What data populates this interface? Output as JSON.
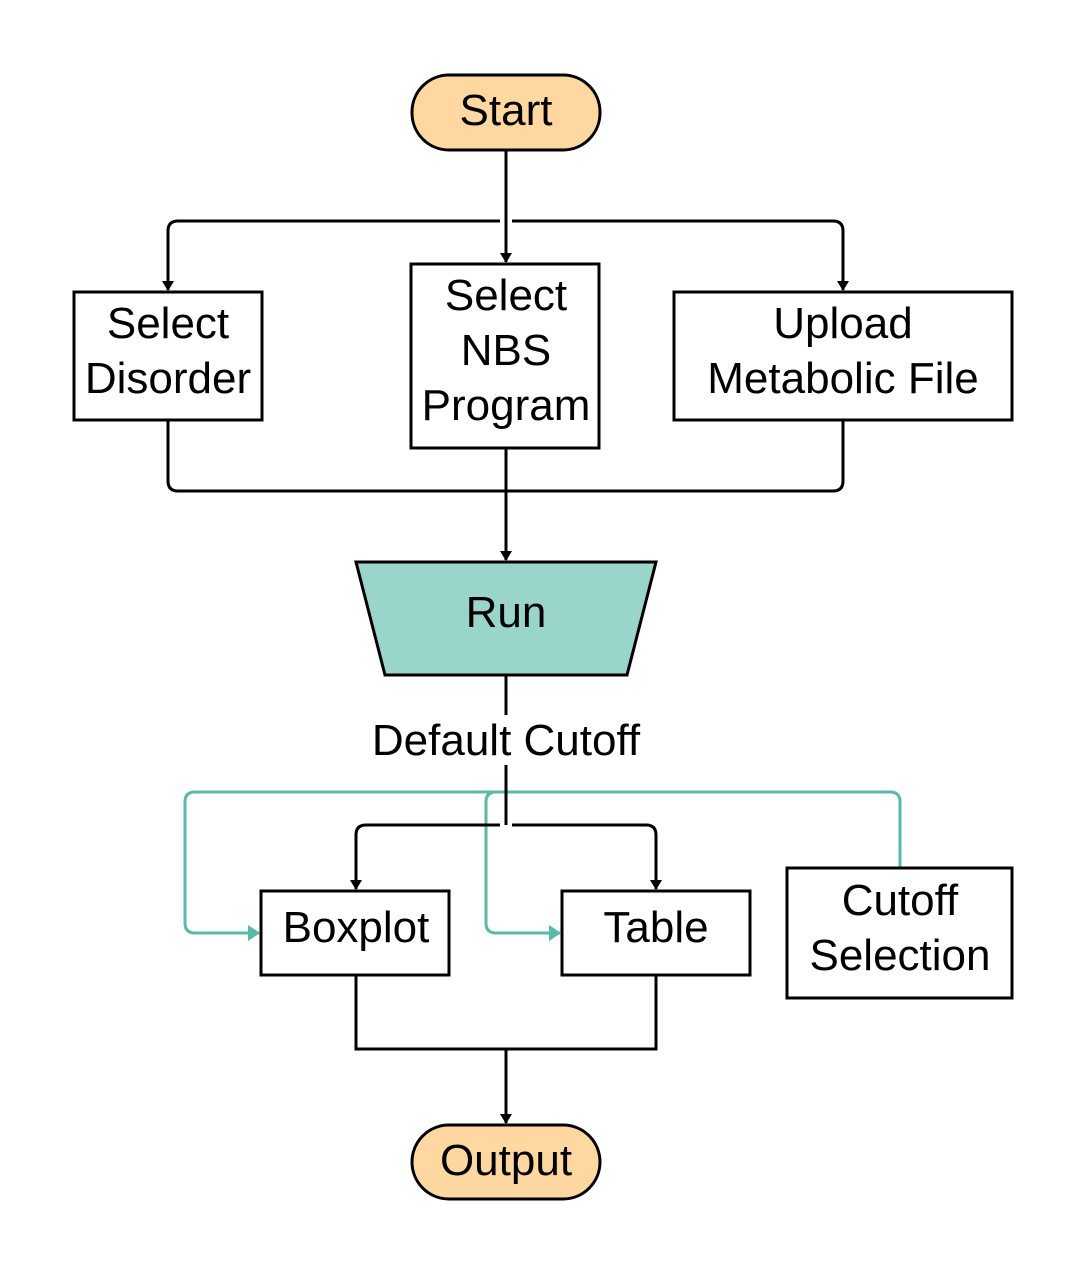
{
  "colors": {
    "terminal_fill": "#fed8a0",
    "run_fill": "#9ad5cb",
    "cutoff_arrow": "#5bb9a7",
    "line": "#000000"
  },
  "nodes": {
    "start": "Start",
    "select_disorder": [
      "Select",
      "Disorder"
    ],
    "select_nbs": [
      "Select",
      "NBS",
      "Program"
    ],
    "upload": [
      "Upload",
      "Metabolic File"
    ],
    "run": "Run",
    "boxplot": "Boxplot",
    "table": "Table",
    "cutoff_selection": [
      "Cutoff",
      "Selection"
    ],
    "output": "Output"
  },
  "edge_labels": {
    "default_cutoff": "Default Cutoff"
  }
}
